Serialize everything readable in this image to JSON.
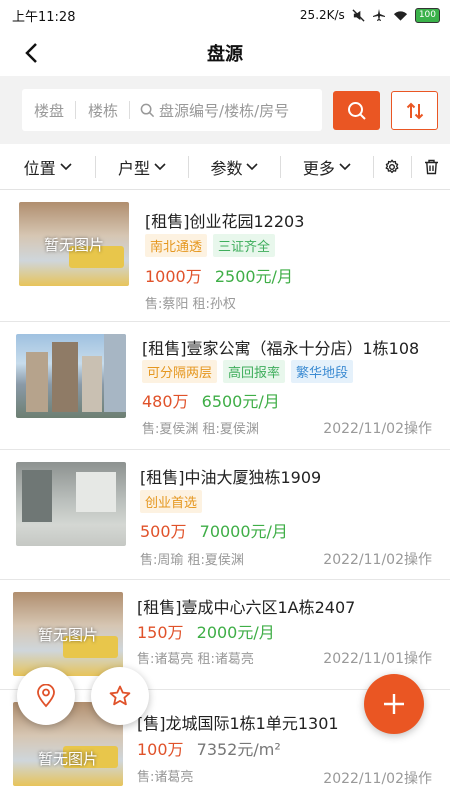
{
  "status_bar": {
    "time": "上午11:28",
    "net_speed": "25.2K/s",
    "battery": "100"
  },
  "header": {
    "title": "盘源"
  },
  "search": {
    "seg1": "楼盘",
    "seg2": "楼栋",
    "placeholder": "盘源编号/楼栋/房号"
  },
  "filters": [
    {
      "label": "位置"
    },
    {
      "label": "户型"
    },
    {
      "label": "参数"
    },
    {
      "label": "更多"
    }
  ],
  "listings": [
    {
      "title": "[租售]创业花园12203",
      "image_label": "暂无图片",
      "tags": [
        {
          "text": "南北通透",
          "style": "orange"
        },
        {
          "text": "三证齐全",
          "style": "green"
        }
      ],
      "sale_price": "1000万",
      "rent_price": "2500元/月",
      "agents": "售:蔡阳 租:孙权",
      "date": ""
    },
    {
      "title": "[租售]壹家公寓（福永十分店）1栋108",
      "image_label": "",
      "tags": [
        {
          "text": "可分隔两层",
          "style": "orange"
        },
        {
          "text": "高回报率",
          "style": "green"
        },
        {
          "text": "繁华地段",
          "style": "blue"
        }
      ],
      "sale_price": "480万",
      "rent_price": "6500元/月",
      "agents": "售:夏侯渊 租:夏侯渊",
      "date": "2022/11/02操作"
    },
    {
      "title": "[租售]中油大厦独栋1909",
      "image_label": "",
      "tags": [
        {
          "text": "创业首选",
          "style": "orange"
        }
      ],
      "sale_price": "500万",
      "rent_price": "70000元/月",
      "agents": "售:周瑜 租:夏侯渊",
      "date": "2022/11/02操作"
    },
    {
      "title": "[租售]壹成中心六区1A栋2407",
      "image_label": "暂无图片",
      "tags": [],
      "sale_price": "150万",
      "rent_price": "2000元/月",
      "agents": "售:诸葛亮 租:诸葛亮",
      "date": "2022/11/01操作"
    },
    {
      "title": "[售]龙城国际1栋1单元1301",
      "image_label": "暂无图片",
      "tags": [],
      "sale_price": "100万",
      "rent_price": "7352元/m²",
      "agents": "售:诸葛亮",
      "date": "2022/11/02操作"
    }
  ],
  "colors": {
    "accent": "#ea5623",
    "sale_price": "#e0522a",
    "rent_price": "#3fae47"
  }
}
